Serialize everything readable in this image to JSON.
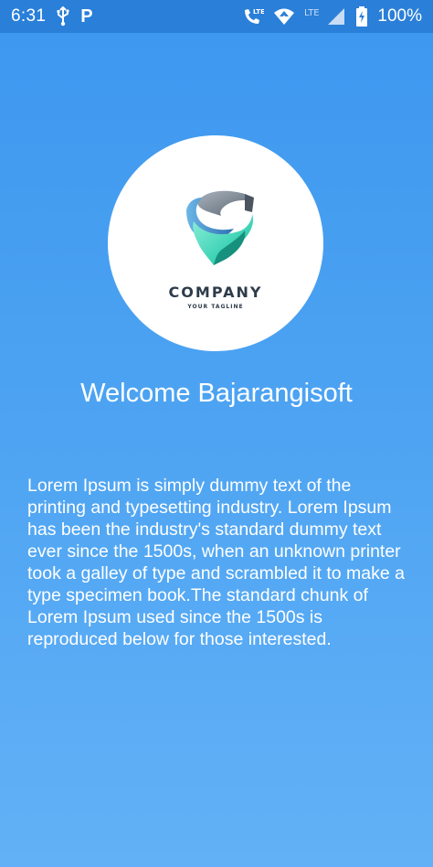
{
  "status_bar": {
    "time": "6:31",
    "carrier_icon": "P",
    "lte_label_1": "LTE",
    "lte_label_2": "LTE",
    "battery_percent": "100%",
    "icons": [
      "usb-icon",
      "parking-icon",
      "volte-call-icon",
      "wifi-icon",
      "signal-icon",
      "battery-charging-icon"
    ]
  },
  "logo": {
    "name": "COMPANY",
    "tagline": "YOUR TAGLINE",
    "colors": {
      "teal": "#3fd3b6",
      "blue": "#2f86c9",
      "grey": "#6b7785"
    }
  },
  "welcome": {
    "title": "Welcome Bajarangisoft"
  },
  "content": {
    "paragraph": "Lorem Ipsum is simply dummy text of the printing and typesetting industry. Lorem Ipsum has been the industry's standard dummy text ever since the 1500s, when an unknown printer took a galley of type and scrambled it to make a type specimen book.The standard chunk of Lorem Ipsum used since the 1500s is reproduced below for those interested."
  },
  "theme": {
    "status_bar_bg": "#2a7fd8",
    "gradient_top": "#3d97ef",
    "gradient_bottom": "#62b1f6",
    "text_color": "#ffffff"
  }
}
